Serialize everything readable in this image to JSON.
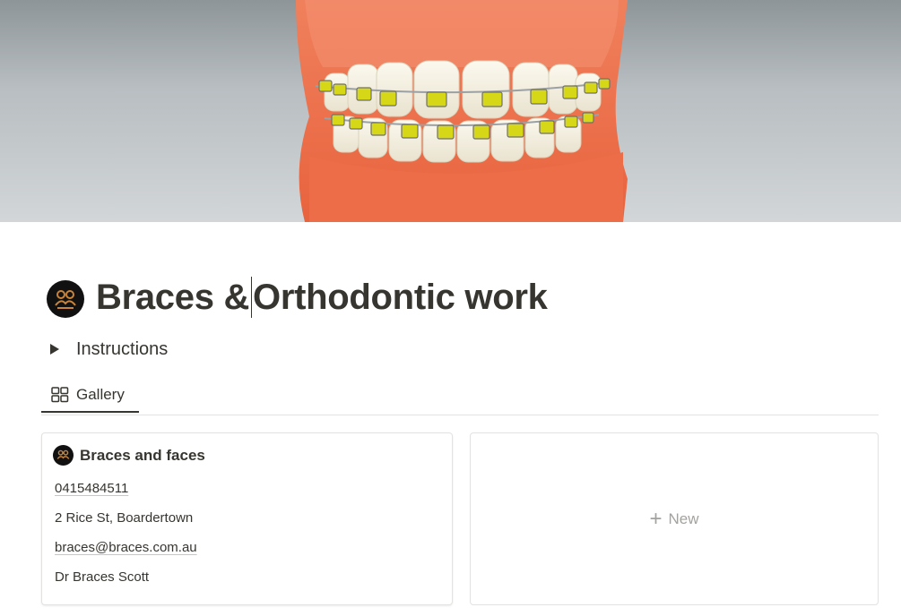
{
  "page": {
    "title_part1": "Braces &",
    "title_part2": "Orthodontic work",
    "icon": "people-logo-icon"
  },
  "toggle": {
    "label": "Instructions"
  },
  "views": [
    {
      "label": "Gallery",
      "icon": "gallery-grid-icon",
      "active": true
    }
  ],
  "cards": [
    {
      "title": "Braces and faces",
      "icon": "people-logo-icon",
      "phone": "0415484511",
      "address": "2 Rice St, Boardertown",
      "email": "braces@braces.com.au",
      "contact": "Dr Braces Scott"
    }
  ],
  "new_card": {
    "plus": "+",
    "label": "New"
  },
  "colors": {
    "text": "#37352f",
    "muted": "#a3a29e",
    "border": "#e3e2e0",
    "logo_accent": "#c8843a"
  }
}
